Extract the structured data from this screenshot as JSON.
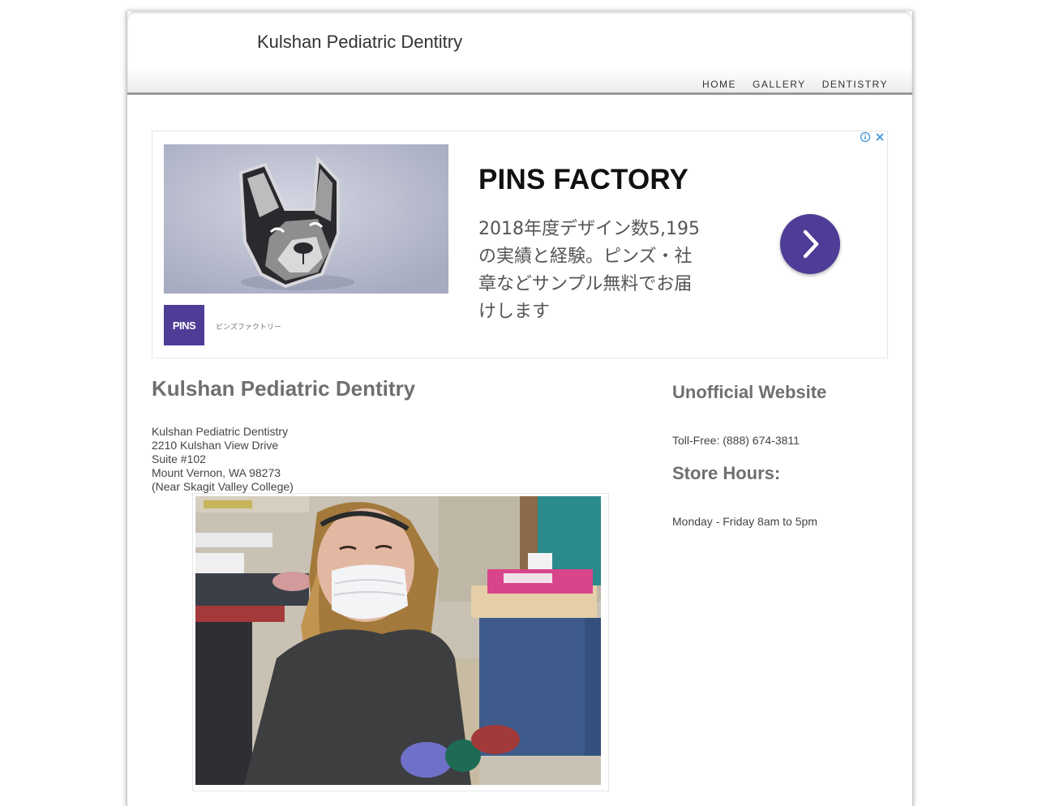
{
  "header": {
    "site_title": "Kulshan Pediatric Dentitry",
    "nav": [
      "HOME",
      "GALLERY",
      "DENTISTRY"
    ]
  },
  "ad": {
    "headline": "PINS FACTORY",
    "body_lines": [
      "2018年度デザイン数5,195",
      "の実績と経験。ピンズ・社",
      "章などサンプル無料でお届",
      "けします"
    ],
    "logo_text": "PINS",
    "brand_small": "ピンズファクトリー",
    "accent_color": "#4e3c96",
    "icons": [
      "info-icon",
      "close-icon",
      "chevron-right-icon"
    ]
  },
  "main": {
    "title": "Kulshan Pediatric Dentitry",
    "address_lines": [
      "Kulshan Pediatric Dentistry",
      "2210 Kulshan View Drive",
      "Suite #102",
      "Mount Vernon, WA 98273",
      "(Near Skagit Valley College)"
    ]
  },
  "sidebar": {
    "unofficial_heading": "Unofficial Website",
    "phone": "Toll-Free: (888) 674-3811",
    "hours_heading": "Store Hours:",
    "hours": "Monday - Friday 8am to 5pm"
  }
}
